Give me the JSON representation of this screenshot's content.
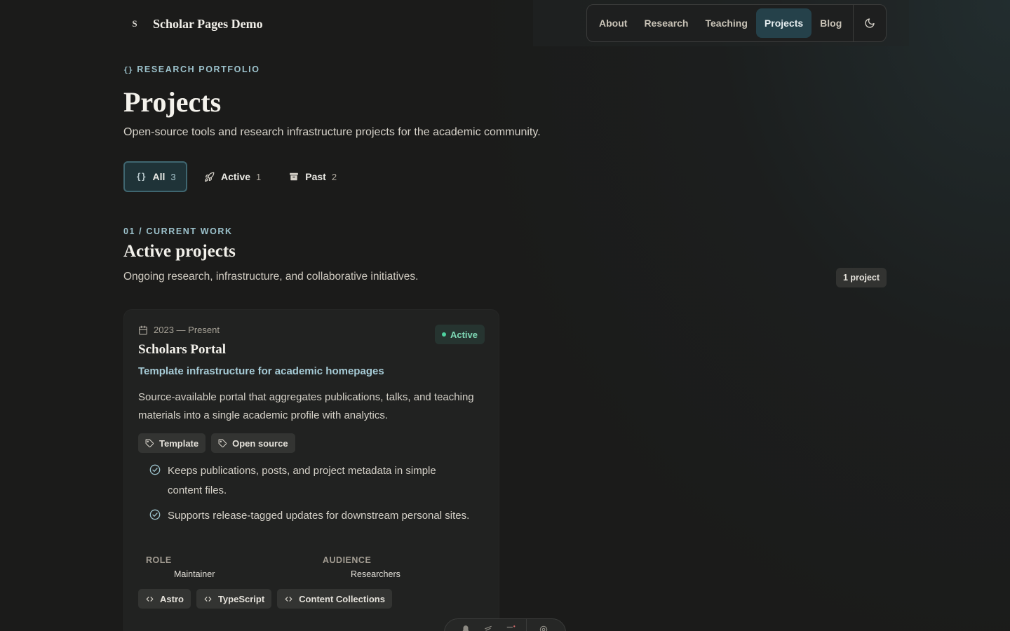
{
  "site": {
    "brand_mark": "S",
    "brand_name": "Scholar Pages Demo"
  },
  "nav": {
    "items": [
      {
        "label": "About",
        "active": false
      },
      {
        "label": "Research",
        "active": false
      },
      {
        "label": "Teaching",
        "active": false
      },
      {
        "label": "Projects",
        "active": true
      },
      {
        "label": "Blog",
        "active": false
      }
    ],
    "theme_icon": "moon-icon"
  },
  "hero": {
    "eyebrow_icon": "{}",
    "eyebrow": "RESEARCH PORTFOLIO",
    "title": "Projects",
    "description": "Open-source tools and research infrastructure projects for the academic community."
  },
  "filters": [
    {
      "icon": "braces-icon",
      "label": "All",
      "count": "3",
      "active": true
    },
    {
      "icon": "rocket-icon",
      "label": "Active",
      "count": "1",
      "active": false
    },
    {
      "icon": "archive-icon",
      "label": "Past",
      "count": "2",
      "active": false
    }
  ],
  "section": {
    "eyebrow": "01 / CURRENT WORK",
    "title": "Active projects",
    "description": "Ongoing research, infrastructure, and collaborative initiatives.",
    "count_badge": "1 project"
  },
  "project": {
    "date": "2023 — Present",
    "status": "Active",
    "title": "Scholars Portal",
    "subtitle": "Template infrastructure for academic homepages",
    "description": "Source-available portal that aggregates publications, talks, and teaching materials into a single academic profile with analytics.",
    "tags": [
      "Template",
      "Open source"
    ],
    "highlights": [
      "Keeps publications, posts, and project metadata in simple content files.",
      "Supports release-tagged updates for downstream personal sites."
    ],
    "role_label": "ROLE",
    "role": "Maintainer",
    "audience_label": "AUDIENCE",
    "audience": "Researchers",
    "tech": [
      "Astro",
      "TypeScript",
      "Content Collections"
    ]
  },
  "colors": {
    "accent": "#9cc2cc",
    "active_nav": "#25414a",
    "status_green": "#4ed2a0",
    "background": "#1b1b1a"
  }
}
